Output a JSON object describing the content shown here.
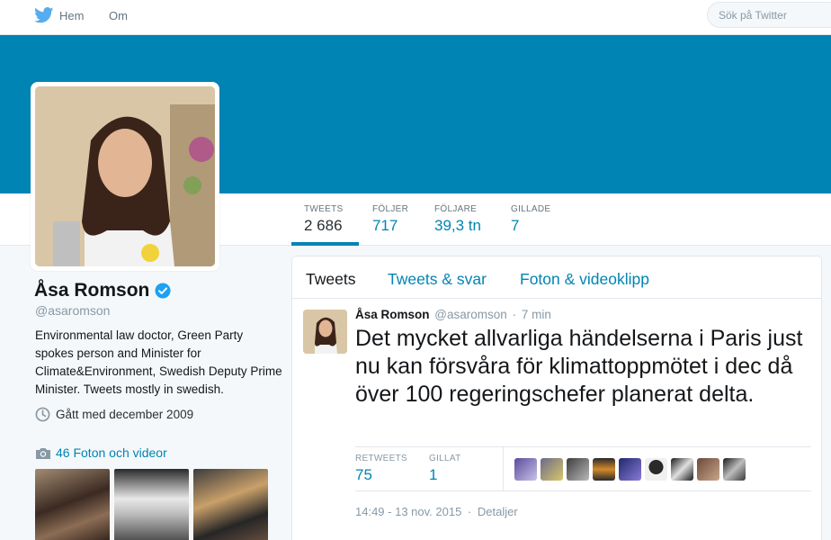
{
  "nav": {
    "home_label": "Hem",
    "about_label": "Om",
    "search_placeholder": "Sök på Twitter"
  },
  "colors": {
    "brand": "#0084b4",
    "verified": "#1da1f2"
  },
  "stats": [
    {
      "label": "TWEETS",
      "value": "2 686"
    },
    {
      "label": "FÖLJER",
      "value": "717"
    },
    {
      "label": "FÖLJARE",
      "value": "39,3 tn"
    },
    {
      "label": "GILLADE",
      "value": "7"
    }
  ],
  "profile": {
    "name": "Åsa Romson",
    "handle": "@asaromson",
    "bio": "Environmental law doctor, Green Party spokes person and Minister for Climate&Environment, Swedish Deputy Prime Minister. Tweets mostly in swedish.",
    "joined": "Gått med december 2009",
    "photos_label": "46 Foton och videor"
  },
  "timeline": {
    "tabs": [
      "Tweets",
      "Tweets & svar",
      "Foton & videoklipp"
    ]
  },
  "tweet": {
    "name": "Åsa Romson",
    "handle": "@asaromson",
    "dot": "·",
    "time": "7 min",
    "text": "Det mycket allvarliga händelserna i Paris just nu kan försvåra för klimattoppmötet i dec då över 100 regeringschefer planerat delta.",
    "retweets_label": "RETWEETS",
    "retweets_value": "75",
    "likes_label": "GILLAT",
    "likes_value": "1",
    "date": "14:49 - 13 nov. 2015",
    "date_sep": "·",
    "details_label": "Detaljer"
  }
}
